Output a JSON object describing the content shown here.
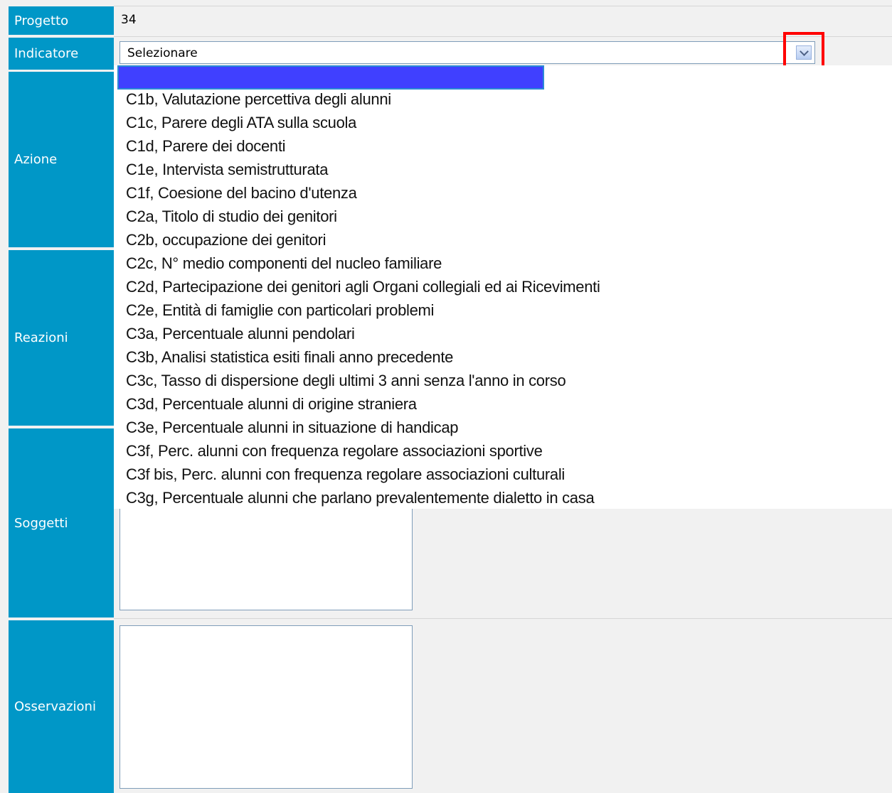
{
  "form": {
    "labels": {
      "progetto": "Progetto",
      "indicatore": "Indicatore",
      "azione": "Azione",
      "reazioni": "Reazioni",
      "soggetti": "Soggetti",
      "osservazioni": "Osservazioni"
    },
    "progetto_value": "34",
    "indicatore_select": {
      "value": "Selezionare",
      "options": [
        "",
        "C1b, Valutazione percettiva degli alunni",
        "C1c, Parere degli ATA sulla scuola",
        "C1d, Parere dei docenti",
        "C1e, Intervista semistrutturata",
        "C1f, Coesione del bacino d'utenza",
        "C2a, Titolo di studio dei genitori",
        "C2b, occupazione dei genitori",
        "C2c, N° medio componenti del nucleo familiare",
        "C2d, Partecipazione dei genitori agli Organi collegiali ed ai Ricevimenti",
        "C2e, Entità di famiglie con particolari problemi",
        "C3a, Percentuale alunni pendolari",
        "C3b, Analisi statistica esiti finali anno precedente",
        "C3c, Tasso di dispersione degli ultimi 3 anni senza l'anno in corso",
        "C3d, Percentuale alunni di origine straniera",
        "C3e, Percentuale alunni in situazione di handicap",
        "C3f, Perc. alunni con frequenza regolare associazioni sportive",
        "C3f bis, Perc. alunni con frequenza regolare associazioni culturali",
        "C3g, Percentuale alunni che parlano prevalentemente dialetto in casa"
      ]
    }
  },
  "colors": {
    "label_bg": "#0097c7",
    "highlight": "#4040ff",
    "annotation": "#ff0000"
  }
}
